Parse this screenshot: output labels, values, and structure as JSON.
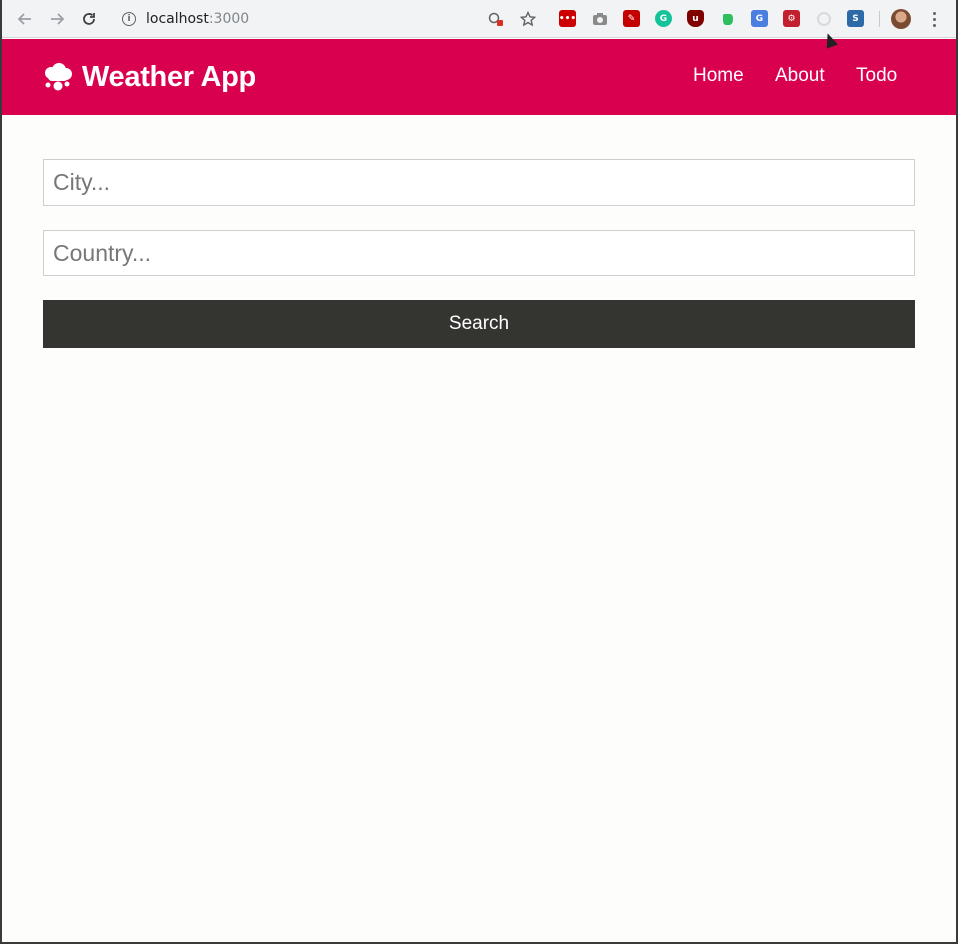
{
  "browser": {
    "url_host": "localhost",
    "url_port": ":3000",
    "back_icon": "arrow-left-icon",
    "forward_icon": "arrow-right-icon",
    "reload_icon": "reload-icon",
    "extensions": [
      {
        "name": "lastpass-extension",
        "color": "#cc0000"
      },
      {
        "name": "camera-extension",
        "color": "#8a8a8a"
      },
      {
        "name": "pen-extension",
        "color": "#c40000"
      },
      {
        "name": "grammarly-extension",
        "color": "#15c39a"
      },
      {
        "name": "ublock-extension",
        "color": "#800000"
      },
      {
        "name": "evernote-extension",
        "color": "#2dbe60"
      },
      {
        "name": "translate-extension",
        "color": "#4a7ee0"
      },
      {
        "name": "react-devtools-extension",
        "color": "#c2202e"
      },
      {
        "name": "loading-extension",
        "color": "#d9d9d9"
      },
      {
        "name": "s-extension",
        "color": "#2c6aa8"
      }
    ]
  },
  "app": {
    "brand": "Weather App",
    "brand_color": "#d8004f",
    "nav": [
      "Home",
      "About",
      "Todo"
    ]
  },
  "form": {
    "city_placeholder": "City...",
    "country_placeholder": "Country...",
    "search_label": "Search"
  }
}
